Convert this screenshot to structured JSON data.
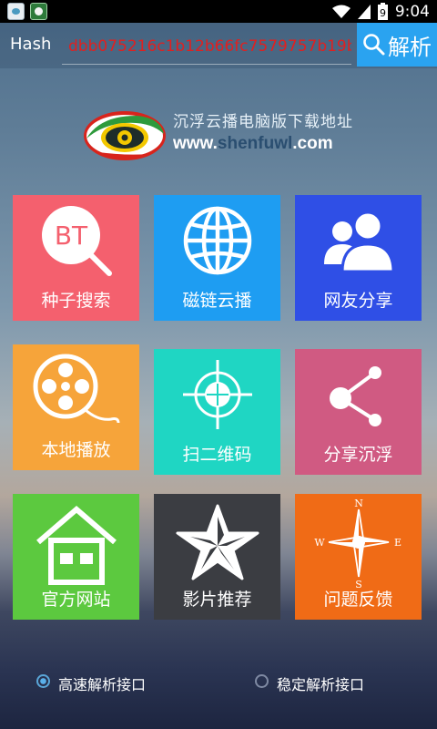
{
  "status_bar": {
    "time": "9:04",
    "icons": [
      "app-icon-1",
      "app-icon-2",
      "wifi-icon",
      "signal-icon",
      "battery-icon"
    ],
    "battery_level": "9"
  },
  "header": {
    "hash_label": "Hash",
    "hash_value": "dbb075216c1b12b66fc7579757b19b7",
    "parse_button": "解析"
  },
  "logo": {
    "line1": "沉浮云播电脑版下载地址",
    "url_prefix": "www.",
    "url_highlight": "shenfuwl",
    "url_suffix": ".com"
  },
  "tiles": [
    {
      "label": "种子搜索",
      "icon": "bt-search-icon",
      "color": "#f4606e"
    },
    {
      "label": "磁链云播",
      "icon": "globe-icon",
      "color": "#1e9df2"
    },
    {
      "label": "网友分享",
      "icon": "users-icon",
      "color": "#2f4fe6"
    },
    {
      "label": "本地播放",
      "icon": "film-reel-icon",
      "color": "#f6a43a"
    },
    {
      "label": "扫二维码",
      "icon": "crosshair-icon",
      "color": "#1fd6c3"
    },
    {
      "label": "分享沉浮",
      "icon": "share-icon",
      "color": "#d05a82"
    },
    {
      "label": "官方网站",
      "icon": "home-icon",
      "color": "#5cc93f"
    },
    {
      "label": "影片推荐",
      "icon": "star-icon",
      "color": "#3b3d42"
    },
    {
      "label": "问题反馈",
      "icon": "compass-icon",
      "color": "#f06b16"
    }
  ],
  "compass_letters": {
    "n": "N",
    "s": "S",
    "e": "E",
    "w": "W"
  },
  "radio_options": [
    {
      "label": "高速解析接口",
      "selected": true
    },
    {
      "label": "稳定解析接口",
      "selected": false
    }
  ]
}
